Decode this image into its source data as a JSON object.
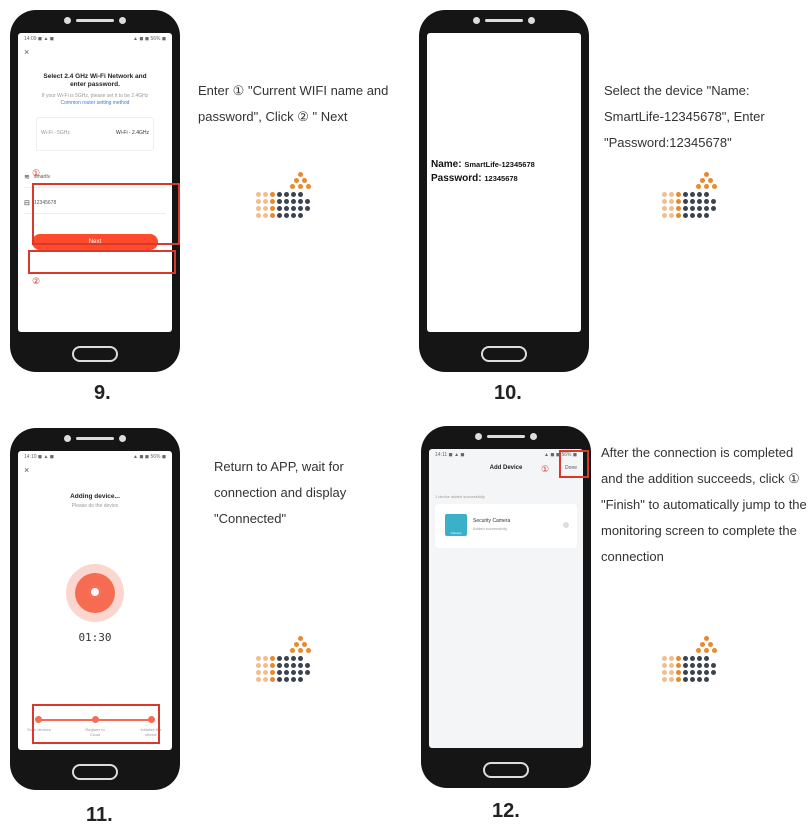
{
  "steps": [
    {
      "number": "9.",
      "caption": "Enter ① \"Current WIFI name and password\", Click ② \" Next",
      "screen": {
        "status_left": "14:09 ◼ ▲ ◼",
        "status_right": "▲ ◼ ◼ 56% ◼",
        "close": "×",
        "title": "Select 2.4 GHz Wi-Fi Network and enter password.",
        "subtitle": "If your Wi-Fi is 5GHz, please set it to be 2.4GHz",
        "subtitle2": "Common router setting method",
        "freq_left": "Wi-Fi - 5GHz",
        "freq_right": "Wi-Fi - 2.4GHz",
        "wifi_name": "smartlv",
        "wifi_password": "12345678",
        "next_label": "Next",
        "marker1": "①",
        "marker2": "②"
      }
    },
    {
      "number": "10.",
      "caption": "Select the device \"Name: SmartLife-12345678\", Enter \"Password:12345678\"",
      "screen": {
        "name_label": "Name:",
        "name_value": "SmartLife-12345678",
        "password_label": "Password:",
        "password_value": "12345678"
      }
    },
    {
      "number": "11.",
      "caption": "Return to APP, wait for connection and display \"Connected\"",
      "screen": {
        "status_left": "14:10 ◼ ▲ ◼",
        "status_right": "▲ ◼ ◼ 56% ◼",
        "close": "×",
        "title": "Adding device...",
        "subtitle": "Please do the device",
        "timer": "01:30",
        "progress_steps": [
          "Scan devices",
          "Register to Cloud",
          "Initialize the device"
        ]
      }
    },
    {
      "number": "12.",
      "caption": "After the connection is completed and the addition succeeds, click ① \"Finish\" to automatically jump to the monitoring screen to complete the connection",
      "screen": {
        "status_left": "14:11 ◼ ▲ ◼",
        "status_right": "▲ ◼ ◼ 56% ◼",
        "title": "Add Device",
        "done_label": "Done",
        "section_label": "1 device added successfully",
        "device_name": "Security Camera",
        "device_status": "Added successfully",
        "device_thumb_label": "Camera",
        "marker1": "①"
      }
    }
  ],
  "colors": {
    "accent_red": "#d73a2c",
    "button_orange": "#ff4b2b",
    "arrow_orange": "#e7892f",
    "arrow_dark": "#3b4352"
  }
}
